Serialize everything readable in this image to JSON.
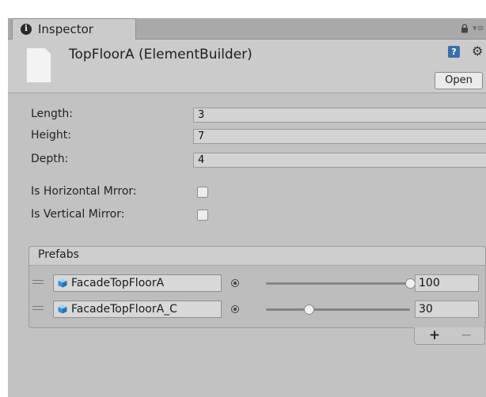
{
  "tab": {
    "label": "Inspector",
    "info_icon": "i"
  },
  "header": {
    "title": "TopFloorA (ElementBuilder)",
    "open_label": "Open"
  },
  "fields": [
    {
      "label": "Length:",
      "value": "3"
    },
    {
      "label": "Height:",
      "value": "7"
    },
    {
      "label": "Depth:",
      "value": "4"
    }
  ],
  "toggles": [
    {
      "label": "Is Horizontal Mrror:",
      "checked": false
    },
    {
      "label": "Is Vertical Mirror:",
      "checked": false
    }
  ],
  "prefabs": {
    "title": "Prefabs",
    "items": [
      {
        "name": "FacadeTopFloorA",
        "value": "100",
        "fraction": 1.0
      },
      {
        "name": "FacadeTopFloorA_C",
        "value": "30",
        "fraction": 0.3
      }
    ],
    "add_label": "+",
    "remove_label": "−"
  },
  "colors": {
    "window_bg": "#c2c2c2",
    "header_bg": "#cbcbcb",
    "tab_strip": "#a9a9a9",
    "cube_blue": "#4aa3e6"
  },
  "icons": [
    "info-icon",
    "lock-icon",
    "menu-icon",
    "file-icon",
    "help-icon",
    "gear-icon",
    "drag-handle-icon",
    "cube-icon",
    "target-icon"
  ]
}
